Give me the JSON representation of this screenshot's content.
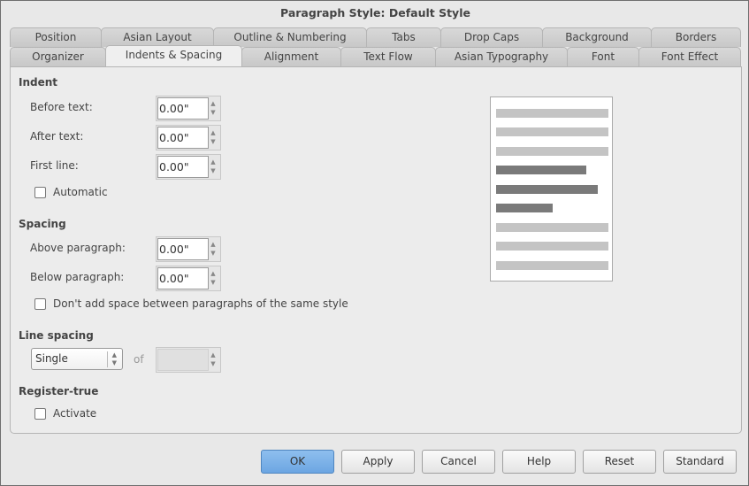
{
  "window": {
    "title": "Paragraph Style: Default Style"
  },
  "tabs_row1": [
    "Position",
    "Asian Layout",
    "Outline & Numbering",
    "Tabs",
    "Drop Caps",
    "Background",
    "Borders"
  ],
  "tabs_row2": [
    "Organizer",
    "Indents & Spacing",
    "Alignment",
    "Text Flow",
    "Asian Typography",
    "Font",
    "Font Effect"
  ],
  "active_tab": "Indents & Spacing",
  "indent": {
    "heading": "Indent",
    "before_label": "Before text:",
    "before_value": "0.00\"",
    "after_label": "After text:",
    "after_value": "0.00\"",
    "first_label": "First line:",
    "first_value": "0.00\"",
    "automatic_label": "Automatic",
    "automatic_checked": false
  },
  "spacing": {
    "heading": "Spacing",
    "above_label": "Above paragraph:",
    "above_value": "0.00\"",
    "below_label": "Below paragraph:",
    "below_value": "0.00\"",
    "noadd_label": "Don't add space between paragraphs of the same style",
    "noadd_checked": false
  },
  "line_spacing": {
    "heading": "Line spacing",
    "value": "Single",
    "of_label": "of",
    "of_value": ""
  },
  "register": {
    "heading": "Register-true",
    "activate_label": "Activate",
    "activate_checked": false
  },
  "buttons": {
    "ok": "OK",
    "apply": "Apply",
    "cancel": "Cancel",
    "help": "Help",
    "reset": "Reset",
    "standard": "Standard"
  },
  "colors": {
    "ok_button": "#7ab1e8",
    "preview_light": "#c4c4c4",
    "preview_dark": "#7a7a7a"
  }
}
